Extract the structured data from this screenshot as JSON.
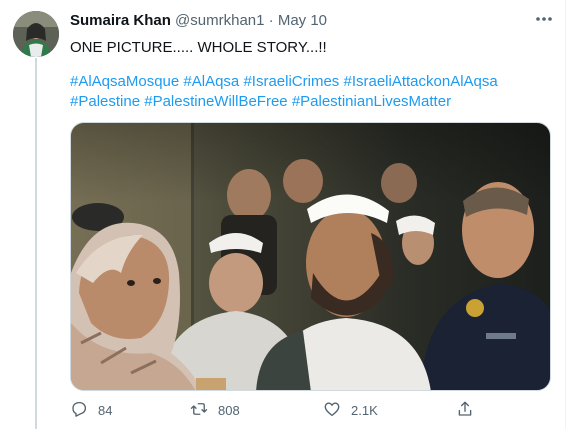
{
  "tweet": {
    "author_name": "Sumaira Khan",
    "handle": "@sumrkhan1",
    "separator": "·",
    "date": "May 10",
    "text": "ONE PICTURE..... WHOLE STORY...!!",
    "hashtags": [
      "#AlAqsaMosque",
      "#AlAqsa",
      "#IsraeliCrimes",
      "#IsraeliAttackonAlAqsa",
      "#Palestine",
      "#PalestineWillBeFree",
      "#PalestinianLivesMatter"
    ]
  },
  "actions": {
    "replies": "84",
    "retweets": "808",
    "likes": "2.1K"
  },
  "colors": {
    "link": "#1d9bf0",
    "muted": "#536471",
    "text": "#0f1419"
  },
  "icons": {
    "more": "more-icon",
    "reply": "reply-icon",
    "retweet": "retweet-icon",
    "like": "heart-icon",
    "share": "share-icon"
  }
}
